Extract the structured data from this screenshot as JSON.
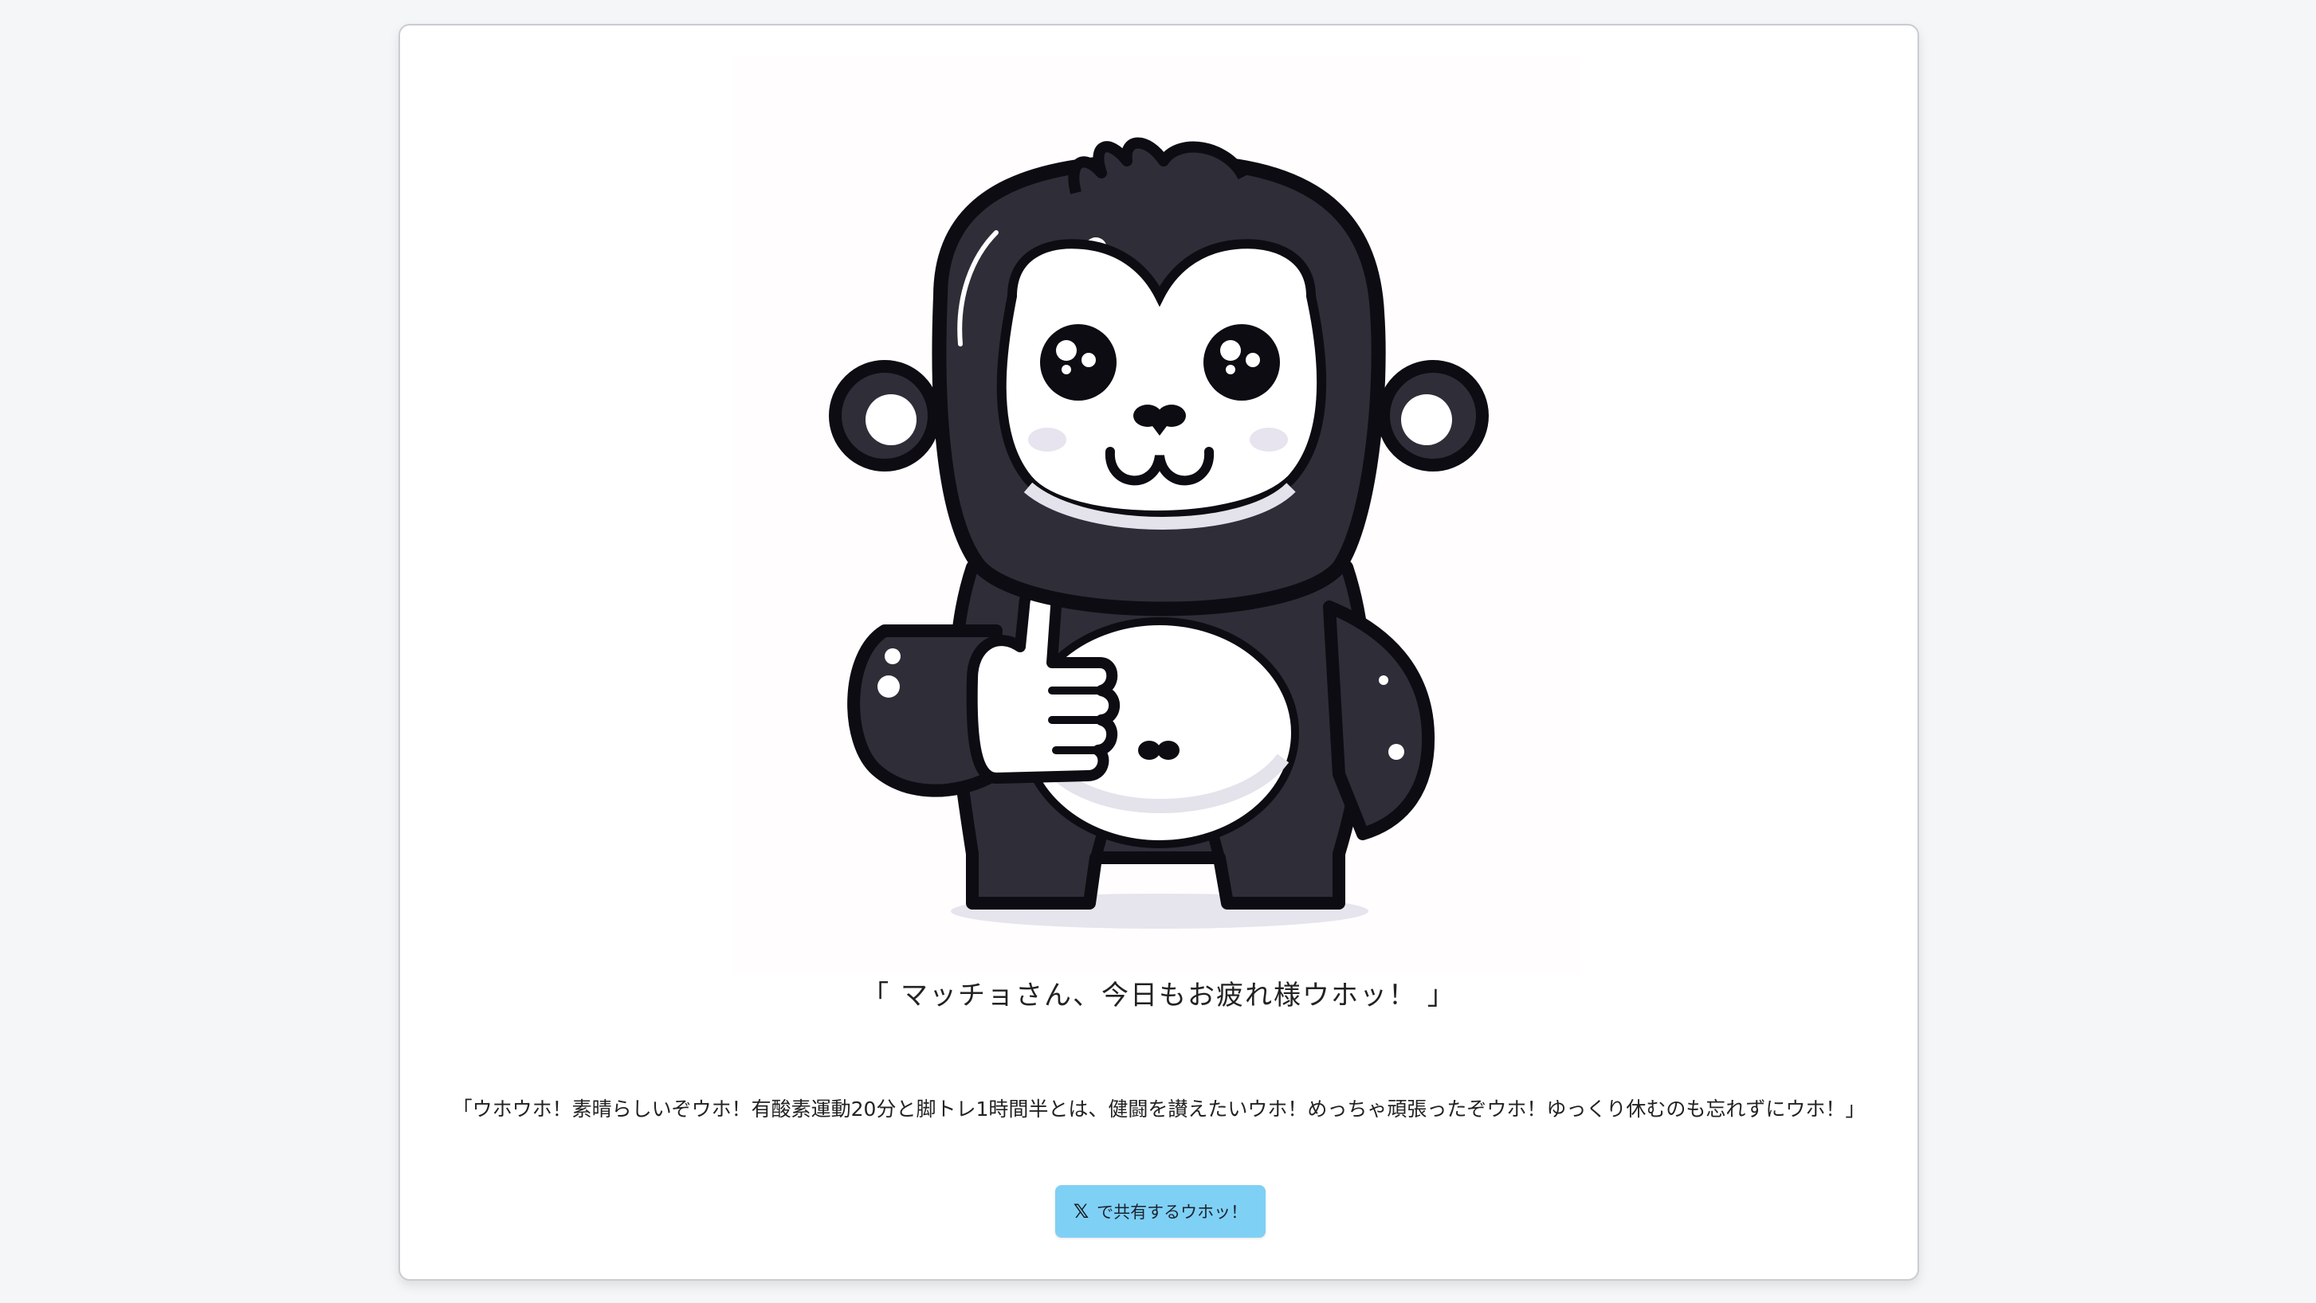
{
  "mascot": {
    "icon": "gorilla-thumbs-up-mascot"
  },
  "greeting": "「 マッチョさん、今日もお疲れ様ウホッ！ 」",
  "message": "「ウホウホ！素晴らしいぞウホ！有酸素運動20分と脚トレ1時間半とは、健闘を讃えたいウホ！めっちゃ頑張ったぞウホ！ゆっくり休むのも忘れずにウホ！」",
  "share_button": {
    "icon_glyph": "𝕏",
    "icon": "x-logo-icon",
    "label": "で共有するウホッ！"
  },
  "colors": {
    "page_background": "#f4f6f8",
    "card_background": "#ffffff",
    "button_background": "#7fd0f5",
    "gorilla_dark": "#2e2d38"
  }
}
